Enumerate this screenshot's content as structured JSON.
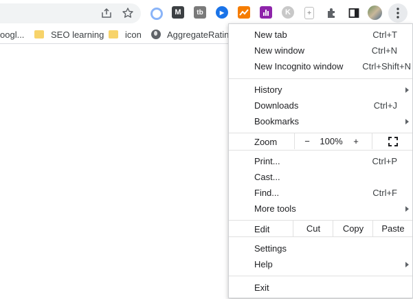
{
  "toolbar": {
    "share_icon": "share-icon",
    "star_icon": "bookmark-star-icon",
    "extensions": [
      {
        "name": "circle-extension-icon",
        "glyph": "",
        "color": "#8ab4f8"
      },
      {
        "name": "m-extension-icon",
        "glyph": "M",
        "color": "#3c4043"
      },
      {
        "name": "tb-extension-icon",
        "glyph": "tb",
        "color": "#7a7a7a"
      },
      {
        "name": "play-extension-icon",
        "glyph": "▶",
        "color": "#1a73e8"
      },
      {
        "name": "chart-extension-icon",
        "glyph": "",
        "color": "#f57c00"
      },
      {
        "name": "bars-extension-icon",
        "glyph": "ıl",
        "color": "#8e24aa"
      },
      {
        "name": "k-extension-icon",
        "glyph": "K",
        "color": "#c8c8c8"
      },
      {
        "name": "clipboard-extension-icon",
        "glyph": "⊞",
        "color": "#bdbdbd"
      }
    ],
    "puzzle_icon": "extensions-puzzle-icon",
    "sidepanel_icon": "side-panel-icon",
    "avatar": "profile-avatar",
    "menu_icon": "kebab-menu-icon"
  },
  "bookmarks": [
    {
      "label": "oogl...",
      "icon": "none"
    },
    {
      "label": "SEO learning",
      "icon": "folder"
    },
    {
      "label": "icon",
      "icon": "folder"
    },
    {
      "label": "AggregateRating",
      "icon": "globe"
    }
  ],
  "menu": {
    "new_tab": {
      "label": "New tab",
      "shortcut": "Ctrl+T"
    },
    "new_window": {
      "label": "New window",
      "shortcut": "Ctrl+N"
    },
    "new_incognito": {
      "label": "New Incognito window",
      "shortcut": "Ctrl+Shift+N"
    },
    "history": {
      "label": "History"
    },
    "downloads": {
      "label": "Downloads",
      "shortcut": "Ctrl+J"
    },
    "bookmarks": {
      "label": "Bookmarks"
    },
    "zoom": {
      "label": "Zoom",
      "minus": "−",
      "value": "100%",
      "plus": "+"
    },
    "print": {
      "label": "Print...",
      "shortcut": "Ctrl+P"
    },
    "cast": {
      "label": "Cast..."
    },
    "find": {
      "label": "Find...",
      "shortcut": "Ctrl+F"
    },
    "more_tools": {
      "label": "More tools"
    },
    "edit": {
      "label": "Edit",
      "cut": "Cut",
      "copy": "Copy",
      "paste": "Paste"
    },
    "settings": {
      "label": "Settings"
    },
    "help": {
      "label": "Help"
    },
    "exit": {
      "label": "Exit"
    }
  }
}
